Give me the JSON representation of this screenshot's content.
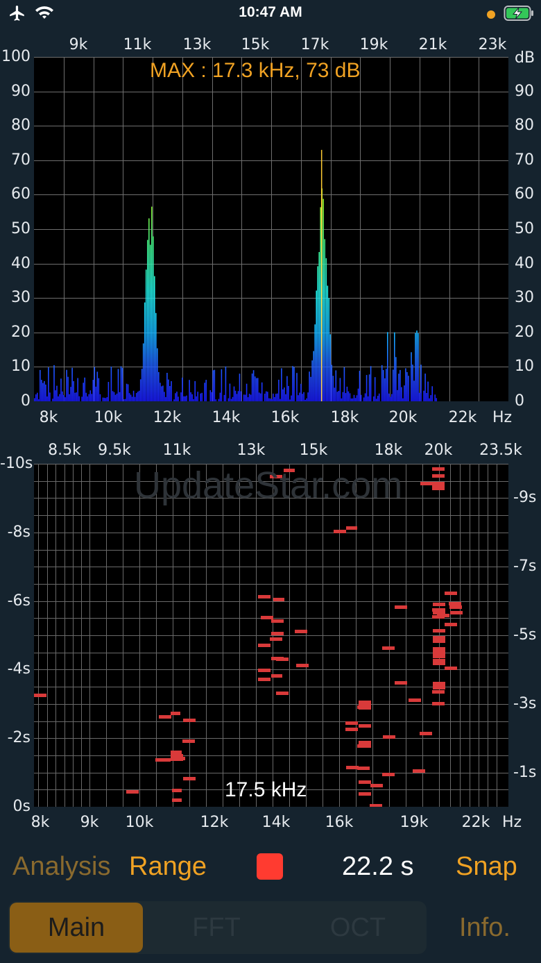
{
  "status": {
    "time": "10:47 AM",
    "icons": [
      "airplane-icon",
      "wifi-icon",
      "orange-dot",
      "battery-charging-icon"
    ]
  },
  "colors": {
    "accent": "#f0a223",
    "record": "#ff3b30",
    "grid": "#6f6f6f",
    "tick": "#e6eaee"
  },
  "spectrum": {
    "max_readout": "MAX :  17.3 kHz,  73 dB",
    "top_ticks": [
      "9k",
      "11k",
      "13k",
      "15k",
      "17k",
      "19k",
      "21k",
      "23k"
    ],
    "bottom_ticks": [
      "8k",
      "10k",
      "12k",
      "14k",
      "16k",
      "18k",
      "20k",
      "22k"
    ],
    "x_unit": "Hz",
    "y_unit": "dB",
    "y_ticks": [
      "100",
      "90",
      "80",
      "70",
      "60",
      "50",
      "40",
      "30",
      "20",
      "10",
      "0"
    ]
  },
  "spectrogram": {
    "watermark": "UpdateStar.com",
    "top_ticks": [
      "8.5k",
      "9.5k",
      "11k",
      "13k",
      "15k",
      "18k",
      "20k",
      "23.5k"
    ],
    "bottom_ticks": [
      "8k",
      "9k",
      "10k",
      "12k",
      "14k",
      "16k",
      "19k",
      "22k"
    ],
    "x_unit": "Hz",
    "left_ticks": [
      "-10s",
      "-8s",
      "-6s",
      "-4s",
      "-2s",
      "0s"
    ],
    "right_ticks": [
      "-9s",
      "-7s",
      "-5s",
      "-3s",
      "-1s"
    ],
    "cursor_readout": "17.5 kHz"
  },
  "controls": {
    "analysis": "Analysis",
    "range": "Range",
    "duration": "22.2 s",
    "snap": "Snap"
  },
  "tabs": [
    {
      "label": "Main",
      "active": true
    },
    {
      "label": "FFT",
      "active": false
    },
    {
      "label": "OCT",
      "active": false
    }
  ],
  "info": "Info."
}
